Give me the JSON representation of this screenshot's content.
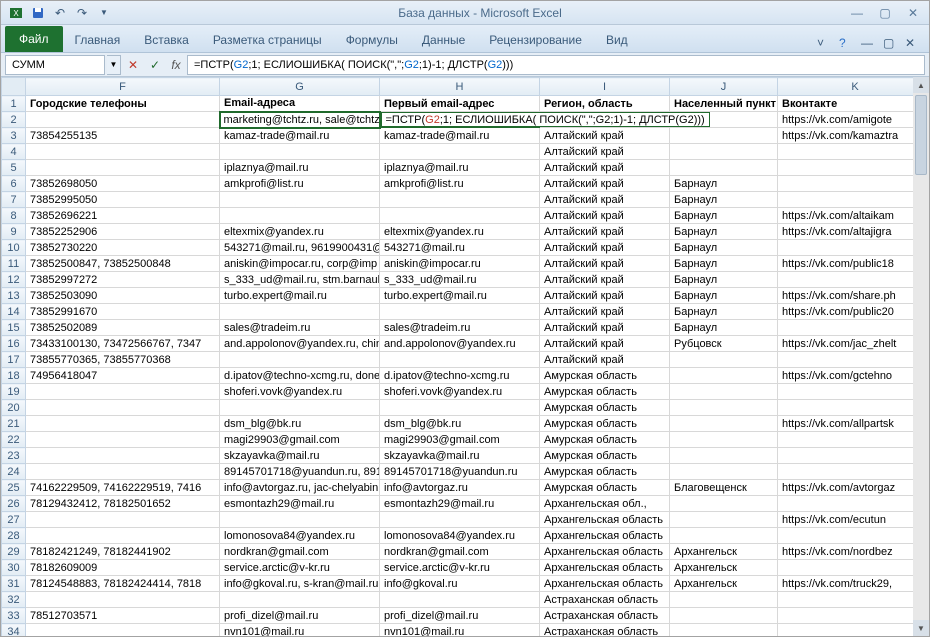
{
  "title": "База данных  -  Microsoft Excel",
  "ribbon": {
    "file": "Файл",
    "tabs": [
      "Главная",
      "Вставка",
      "Разметка страницы",
      "Формулы",
      "Данные",
      "Рецензирование",
      "Вид"
    ]
  },
  "namebox": "СУММ",
  "fx": "fx",
  "formula_prefix": "=ПСТР(",
  "formula_g2a": "G2",
  "formula_mid1": ";1; ЕСЛИОШИБКА( ПОИСК(\",\";",
  "formula_g2b": "G2",
  "formula_mid2": ";1)-1; ДЛСТР(",
  "formula_g2c": "G2",
  "formula_suffix": ")))",
  "formula_edit": "=ПСТР(G2;1; ЕСЛИОШИБКА( ПОИСК(\",\";G2;1)-1; ДЛСТР(G2)))",
  "cols": [
    "F",
    "G",
    "H",
    "I",
    "J",
    "K"
  ],
  "headers": {
    "F": "Городские телефоны",
    "G": "Email-адреса",
    "H": "Первый email-адрес",
    "I": "Регион, область",
    "J": "Населенный пункт",
    "K": "Вконтакте"
  },
  "rows": [
    {
      "n": 2,
      "F": "",
      "G": "marketing@tchtz.ru, sale@tchtz",
      "H": "__EDIT__",
      "I": "",
      "J": "",
      "K": "https://vk.com/amigote"
    },
    {
      "n": 3,
      "F": "73854255135",
      "G": "kamaz-trade@mail.ru",
      "H": "kamaz-trade@mail.ru",
      "I": "Алтайский край",
      "J": "",
      "K": "https://vk.com/kamaztra"
    },
    {
      "n": 4,
      "F": "",
      "G": "",
      "H": "",
      "I": "Алтайский край",
      "J": "",
      "K": ""
    },
    {
      "n": 5,
      "F": "",
      "G": "iplaznya@mail.ru",
      "H": "iplaznya@mail.ru",
      "I": "Алтайский край",
      "J": "",
      "K": ""
    },
    {
      "n": 6,
      "F": "73852698050",
      "G": "amkprofi@list.ru",
      "H": "amkprofi@list.ru",
      "I": "Алтайский край",
      "J": "Барнаул",
      "K": ""
    },
    {
      "n": 7,
      "F": "73852995050",
      "G": "",
      "H": "",
      "I": "Алтайский край",
      "J": "Барнаул",
      "K": ""
    },
    {
      "n": 8,
      "F": "73852696221",
      "G": "",
      "H": "",
      "I": "Алтайский край",
      "J": "Барнаул",
      "K": "https://vk.com/altaikam"
    },
    {
      "n": 9,
      "F": "73852252906",
      "G": "eltexmix@yandex.ru",
      "H": "eltexmix@yandex.ru",
      "I": "Алтайский край",
      "J": "Барнаул",
      "K": "https://vk.com/altajigra"
    },
    {
      "n": 10,
      "F": "73852730220",
      "G": "543271@mail.ru, 9619900431@n",
      "H": "543271@mail.ru",
      "I": "Алтайский край",
      "J": "Барнаул",
      "K": ""
    },
    {
      "n": 11,
      "F": "73852500847, 73852500848",
      "G": "aniskin@impocar.ru, corp@imp",
      "H": "aniskin@impocar.ru",
      "I": "Алтайский край",
      "J": "Барнаул",
      "K": "https://vk.com/public18"
    },
    {
      "n": 12,
      "F": "73852997272",
      "G": "s_333_ud@mail.ru, stm.barnaul",
      "H": "s_333_ud@mail.ru",
      "I": "Алтайский край",
      "J": "Барнаул",
      "K": ""
    },
    {
      "n": 13,
      "F": "73852503090",
      "G": "turbo.expert@mail.ru",
      "H": "turbo.expert@mail.ru",
      "I": "Алтайский край",
      "J": "Барнаул",
      "K": "https://vk.com/share.ph"
    },
    {
      "n": 14,
      "F": "73852991670",
      "G": "",
      "H": "",
      "I": "Алтайский край",
      "J": "Барнаул",
      "K": "https://vk.com/public20"
    },
    {
      "n": 15,
      "F": "73852502089",
      "G": "sales@tradeim.ru",
      "H": "sales@tradeim.ru",
      "I": "Алтайский край",
      "J": "Барнаул",
      "K": ""
    },
    {
      "n": 16,
      "F": "73433100130, 73472566767, 7347",
      "G": "and.appolonov@yandex.ru, chin",
      "H": "and.appolonov@yandex.ru",
      "I": "Алтайский край",
      "J": "Рубцовск",
      "K": "https://vk.com/jac_zhelt"
    },
    {
      "n": 17,
      "F": "73855770365, 73855770368",
      "G": "",
      "H": "",
      "I": "Алтайский край",
      "J": "",
      "K": ""
    },
    {
      "n": 18,
      "F": "74956418047",
      "G": "d.ipatov@techno-xcmg.ru, done",
      "H": "d.ipatov@techno-xcmg.ru",
      "I": "Амурская область",
      "J": "",
      "K": "https://vk.com/gctehno"
    },
    {
      "n": 19,
      "F": "",
      "G": "shoferi.vovk@yandex.ru",
      "H": "shoferi.vovk@yandex.ru",
      "I": "Амурская область",
      "J": "",
      "K": ""
    },
    {
      "n": 20,
      "F": "",
      "G": "",
      "H": "",
      "I": "Амурская область",
      "J": "",
      "K": ""
    },
    {
      "n": 21,
      "F": "",
      "G": "dsm_blg@bk.ru",
      "H": "dsm_blg@bk.ru",
      "I": "Амурская область",
      "J": "",
      "K": "https://vk.com/allpartsk"
    },
    {
      "n": 22,
      "F": "",
      "G": "magi29903@gmail.com",
      "H": "magi29903@gmail.com",
      "I": "Амурская область",
      "J": "",
      "K": ""
    },
    {
      "n": 23,
      "F": "",
      "G": "skzayavka@mail.ru",
      "H": "skzayavka@mail.ru",
      "I": "Амурская область",
      "J": "",
      "K": ""
    },
    {
      "n": 24,
      "F": "",
      "G": "89145701718@yuandun.ru, 8914",
      "H": "89145701718@yuandun.ru",
      "I": "Амурская область",
      "J": "",
      "K": ""
    },
    {
      "n": 25,
      "F": "74162229509, 74162229519, 7416",
      "G": "info@avtorgaz.ru, jac-chelyabin",
      "H": "info@avtorgaz.ru",
      "I": "Амурская область",
      "J": "Благовещенск",
      "K": "https://vk.com/avtorgaz"
    },
    {
      "n": 26,
      "F": "78129432412, 78182501652",
      "G": "esmontazh29@mail.ru",
      "H": "esmontazh29@mail.ru",
      "I": "Архангельская обл.,",
      "J": "",
      "K": ""
    },
    {
      "n": 27,
      "F": "",
      "G": "",
      "H": "",
      "I": "Архангельская область",
      "J": "",
      "K": "https://vk.com/ecutun"
    },
    {
      "n": 28,
      "F": "",
      "G": "lomonosova84@yandex.ru",
      "H": "lomonosova84@yandex.ru",
      "I": "Архангельская область",
      "J": "",
      "K": ""
    },
    {
      "n": 29,
      "F": "78182421249, 78182441902",
      "G": "nordkran@gmail.com",
      "H": "nordkran@gmail.com",
      "I": "Архангельская область",
      "J": "Архангельск",
      "K": "https://vk.com/nordbez"
    },
    {
      "n": 30,
      "F": "78182609009",
      "G": "service.arctic@v-kr.ru",
      "H": "service.arctic@v-kr.ru",
      "I": "Архангельская область",
      "J": "Архангельск",
      "K": ""
    },
    {
      "n": 31,
      "F": "78124548883, 78182424414, 7818",
      "G": "info@gkoval.ru, s-kran@mail.ru",
      "H": "info@gkoval.ru",
      "I": "Архангельская область",
      "J": "Архангельск",
      "K": "https://vk.com/truck29,"
    },
    {
      "n": 32,
      "F": "",
      "G": "",
      "H": "",
      "I": "Астраханская область",
      "J": "",
      "K": ""
    },
    {
      "n": 33,
      "F": "78512703571",
      "G": "profi_dizel@mail.ru",
      "H": "profi_dizel@mail.ru",
      "I": "Астраханская область",
      "J": "",
      "K": ""
    },
    {
      "n": 34,
      "F": "",
      "G": "nvn101@mail.ru",
      "H": "nvn101@mail.ru",
      "I": "Астраханская область",
      "J": "",
      "K": ""
    }
  ]
}
